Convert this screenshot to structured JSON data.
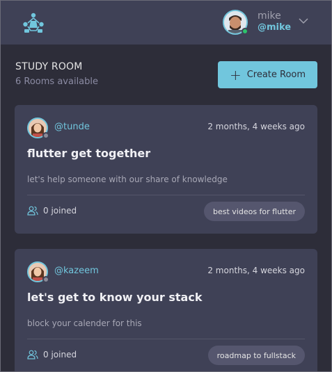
{
  "header": {
    "logo_icon": "study-bud-logo-icon",
    "user": {
      "name": "mike",
      "handle": "@mike",
      "status_color": "#2cc46b"
    },
    "menu_icon": "chevron-down-icon"
  },
  "rooms_section": {
    "title": "STUDY ROOM",
    "count_label": "6 Rooms available",
    "create_button_label": "Create Room",
    "create_icon": "plus-icon"
  },
  "rooms": [
    {
      "host_handle": "@tunde",
      "created": "2 months, 4 weeks ago",
      "name": "flutter get together",
      "description": "let's help someone with our share of knowledge",
      "joined": "0 joined",
      "topic": "best videos for flutter"
    },
    {
      "host_handle": "@kazeem",
      "created": "2 months, 4 weeks ago",
      "name": "let's get to know your stack",
      "description": "block your calender for this",
      "joined": "0 joined",
      "topic": "roadmap to fullstack"
    }
  ],
  "colors": {
    "accent": "#71c6dd",
    "background": "#2d2d39",
    "card": "#3f4156"
  }
}
